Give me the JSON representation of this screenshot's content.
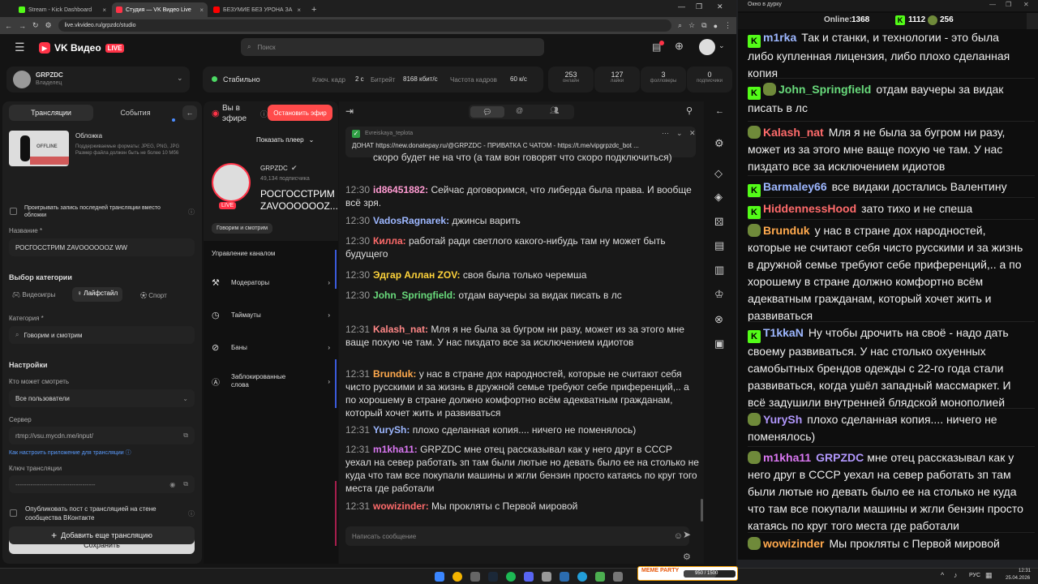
{
  "browser": {
    "tabs": [
      {
        "label": "Stream - Kick Dashboard",
        "color": "#53fc18"
      },
      {
        "label": "Студия — VK Видео Live",
        "color": "#ff3347"
      },
      {
        "label": "БЕЗУМИЕ БЕЗ УРОНА ЗА 4 ЧАСА",
        "color": "#ff0000"
      }
    ],
    "url": "live.vkvideo.ru/grpzdc/studio"
  },
  "vk": {
    "logo_text": "VK Видео",
    "logo_badge": "LIVE",
    "search_placeholder": "Поиск",
    "account": {
      "name": "GRPZDC",
      "role": "Владелец"
    },
    "status": {
      "state": "Стабильно",
      "keyframe_label": "Ключ. кадр",
      "keyframe_value": "2 с",
      "bitrate_label": "Битрейт",
      "bitrate_value": "8168 кбит/с",
      "fps_label": "Частота кадров",
      "fps_value": "60 к/с"
    },
    "stats": [
      {
        "value": "253",
        "label": "онлайн"
      },
      {
        "value": "127",
        "label": "лайки"
      },
      {
        "value": "3",
        "label": "фолловеры"
      },
      {
        "value": "0",
        "label": "подписчики"
      }
    ],
    "left": {
      "tab_broadcasts": "Трансляции",
      "tab_events": "События",
      "cover_title": "Обложка",
      "cover_desc": "Поддерживаемые форматы: JPEG, PNG, JPG Размер файла должен быть не более 10 Мб6",
      "cover_overlay": "OFFLINE",
      "play_last_label": "Проигрывать запись последней трансляции вместо обложки",
      "name_label": "Название *",
      "name_value": "РОСГОССТРИМ ZAVOOOOOOZ WW",
      "category_section": "Выбор категории",
      "cat_games": "Видеоигры",
      "cat_lifestyle": "Лайфстайл",
      "cat_sport": "Спорт",
      "category_label": "Категория *",
      "category_value": "Говорим и смотрим",
      "settings_title": "Настройки",
      "who_label": "Кто может смотреть",
      "who_value": "Все пользователи",
      "server_label": "Сервер",
      "server_value": "rtmp://vsu.mycdn.me/input/",
      "howto_link": "Как настроить приложение для трансляции",
      "key_label": "Ключ трансляции",
      "key_value": "-------------------------------------",
      "publish_label": "Опубликовать пост с трансляцией на стене сообщества ВКонтакте",
      "save_button": "Сохранить",
      "add_button": "Добавить еще трансляцию"
    },
    "middle": {
      "on_air": "Вы в эфире",
      "stop_button": "Остановить эфир",
      "show_player": "Показать плеер",
      "channel_name": "GRPZDC",
      "subscribers": "49,134 подписчика",
      "live_badge": "LIVE",
      "stream_title": "РОСГОССТРИМ ZAVOOOOOOZ...",
      "category_chip": "Говорим и смотрим",
      "manage_title": "Управление каналом",
      "menu": [
        "Модераторы",
        "Таймауты",
        "Баны",
        "Заблокированные слова"
      ]
    },
    "chat": {
      "pinned_user": "Evreiskaya_teplota",
      "pinned_text": "ДОНАТ https://new.donatepay.ru/@GRPZDC - ПРИВАТКА С ЧАТОМ - https://t.me/vipgrpzdc_bot ...",
      "partial_top": "скоро будет не на что (а там вон говорят что скоро подключиться)",
      "messages": [
        {
          "time": "12:30",
          "user": "id86451882:",
          "color": "#ff9bd2",
          "text": "Сейчас договоримся, что либерда была права. И вообще всё зря."
        },
        {
          "time": "12:30",
          "user": "VadosRagnarek:",
          "color": "#9db7ff",
          "text": "джинсы варить"
        },
        {
          "time": "12:30",
          "user": "Килла:",
          "color": "#ff6b6b",
          "text": "работай ради светлого какого-нибудь там ну может быть будущего"
        },
        {
          "time": "12:30",
          "user": "Эдгар Аллан ZOV:",
          "color": "#ffd43b",
          "text": "своя была только черемша"
        },
        {
          "time": "12:30",
          "user": "John_Springfield:",
          "color": "#69db7c",
          "text": "отдам ваучеры за видак писать в лс"
        },
        {
          "time": "12:31",
          "user": "Kalash_nat:",
          "color": "#ff8787",
          "text": "Мля я не была за бугром ни разу, может из за этого мне ваще похую че там. У нас пиздато все за исключением идиотов"
        },
        {
          "time": "12:31",
          "user": "Brunduk:",
          "color": "#ffa94d",
          "text": "у нас в стране дох народностей, которые не считают себя чисто русскими и за жизнь в дружной семье требуют себе приференций,.. а по хорошему в стране должно комфортно всём адекватным гражданам, который хочет жить и развиваться"
        },
        {
          "time": "12:31",
          "user": "YurySh:",
          "color": "#9db7ff",
          "text": "плохо сделанная копия.... ничего не поменялось)"
        },
        {
          "time": "12:31",
          "user": "m1kha11:",
          "color": "#da77f2",
          "text": "GRPZDC мне отец рассказывал как у него друг в СССР уехал на север работать зп там были лютые но девать было ее на столько не куда что там все покупали машины и жгли бензин просто катаясь по круг того места где работали"
        },
        {
          "time": "12:31",
          "user": "wowizinder:",
          "color": "#ff6b6b",
          "text": "Мы прокляты с Первой мировой"
        }
      ],
      "input_placeholder": "Написать сообщение"
    }
  },
  "popout": {
    "title": "Окно в дурку",
    "online_label": "Online:",
    "online_value": "1368",
    "count1": "1112",
    "count2": "256",
    "messages": [
      {
        "user": "m1rka",
        "color": "#9db7ff",
        "text": "Так и станки, и технологии - это была либо купленная лицензия, либо плохо сделанная копия"
      },
      {
        "user": "John_Springfield",
        "color": "#69db7c",
        "text": "отдам ваучеры за видак писать в лс"
      },
      {
        "user": "Kalash_nat",
        "color": "#ff6b6b",
        "text": "Мля я не была за бугром ни разу, может из за этого мне ваще похую че там. У нас пиздато все за исключением идиотов"
      },
      {
        "user": "Barmaley66",
        "color": "#9db7ff",
        "text": "все видаки достались Валентину"
      },
      {
        "user": "HiddennessHood",
        "color": "#ff6b6b",
        "text": "зато тихо и не спеша"
      },
      {
        "user": "Brunduk",
        "color": "#ffa94d",
        "text": "у нас в стране дох народностей, которые не считают себя чисто русскими и за жизнь в дружной семье требуют себе приференций,.. а по хорошему в стране должно комфортно всём адекватным гражданам, который хочет жить и развиваться"
      },
      {
        "user": "T1kkaN",
        "color": "#9db7ff",
        "text": "Ну чтобы дрочить на своё - надо дать своему развиваться. У нас столько охуенных самобытных брендов одежды с 22-го года стали развиваться, когда ушёл западный массмаркет. И всё задушили внутренней блядской монополией"
      },
      {
        "user": "YurySh",
        "color": "#b197fc",
        "text": "плохо сделанная копия.... ничего не поменялось)"
      },
      {
        "user": "m1kha11",
        "color": "#da77f2",
        "mention": "GRPZDC",
        "text": "мне отец рассказывал как у него друг в СССР уехал на север работать зп там были лютые но девать было ее на столько не куда что там все покупали машины и жгли бензин просто катаясь по круг того места где работали"
      },
      {
        "user": "wowizinder",
        "color": "#ffa94d",
        "text": "Мы прокляты с Первой мировой"
      }
    ]
  },
  "taskbar": {
    "meme_label": "MEME PARTY",
    "meme_progress": "950 / 1500",
    "lang": "РУС",
    "time": "12:31",
    "date": "25.04.2026"
  }
}
